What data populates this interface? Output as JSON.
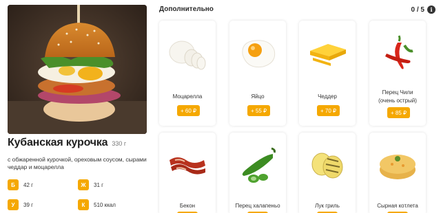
{
  "product": {
    "title": "Кубанская курочка",
    "weight": "330 г",
    "description": "с обжаренной курочкой, ореховым соусом, сырами чеддар и моцарелла"
  },
  "nutrition": [
    {
      "letter": "Б",
      "value": "42 г"
    },
    {
      "letter": "Ж",
      "value": "31 г"
    },
    {
      "letter": "У",
      "value": "39 г"
    },
    {
      "letter": "К",
      "value": "510 ккал"
    }
  ],
  "extras": {
    "title": "Дополнительно",
    "counter": "0 / 5",
    "info_icon": "i",
    "items": [
      {
        "name": "Моцарелла",
        "price": "+ 60 ₽",
        "icon": "mozzarella-icon"
      },
      {
        "name": "Яйцо",
        "price": "+ 55 ₽",
        "icon": "egg-icon"
      },
      {
        "name": "Чеддер",
        "price": "+ 70 ₽",
        "icon": "cheddar-icon"
      },
      {
        "name_line1": "Перец Чили",
        "name_line2": "(очень острый)",
        "price": "+ 85 ₽",
        "icon": "chili-icon"
      },
      {
        "name": "Бекон",
        "icon": "bacon-icon"
      },
      {
        "name": "Перец халапеньо",
        "icon": "jalapeno-icon"
      },
      {
        "name": "Лук гриль",
        "icon": "grilled-onion-icon"
      },
      {
        "name": "Сырная котлета",
        "icon": "cheese-patty-icon"
      }
    ]
  },
  "colors": {
    "accent": "#f5a800"
  }
}
